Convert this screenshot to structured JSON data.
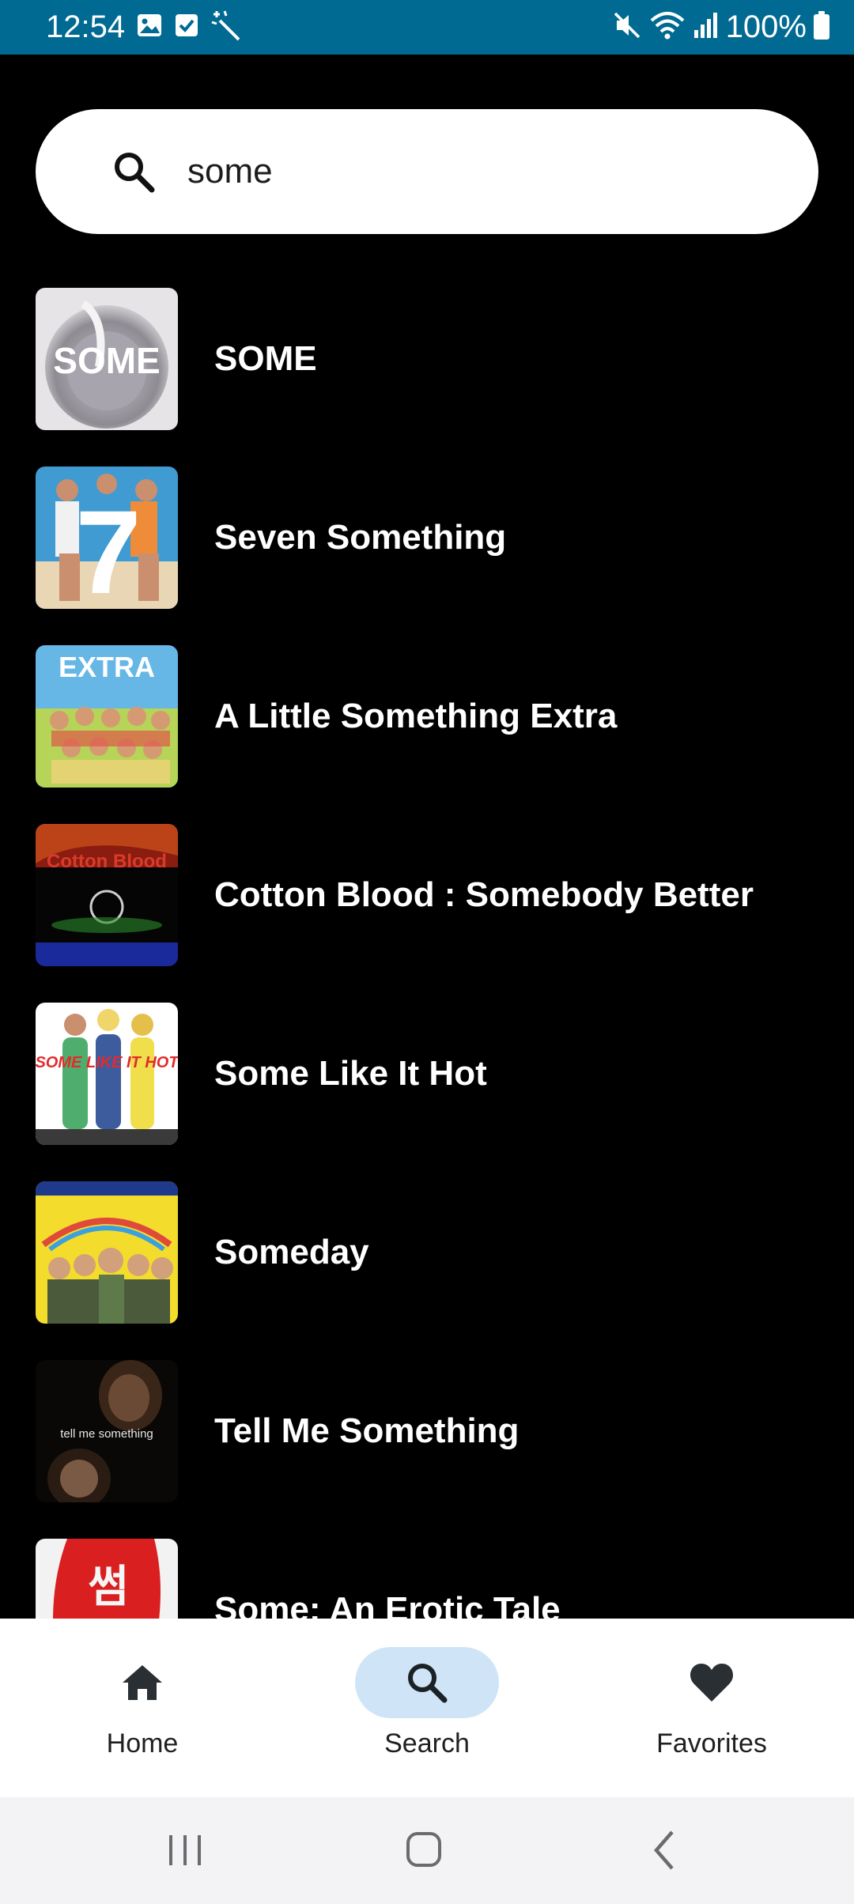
{
  "status_bar": {
    "time": "12:54",
    "left_icons": [
      "image-icon",
      "checkbox-icon",
      "magic-wand-icon"
    ],
    "right_icons": [
      "mute-icon",
      "wifi-icon",
      "signal-icon",
      "battery-icon"
    ],
    "battery_text": "100%",
    "background_color": "#006a93"
  },
  "search": {
    "value": "some",
    "icon": "search-icon"
  },
  "results": [
    {
      "title": "SOME",
      "poster_text": "SOME"
    },
    {
      "title": "Seven Something",
      "poster_text": "7"
    },
    {
      "title": "A Little Something Extra",
      "poster_text": "EXTRA"
    },
    {
      "title": "Cotton Blood : Somebody Better",
      "poster_text": "Cotton Blood"
    },
    {
      "title": "Some Like It Hot",
      "poster_text": "SOME LIKE IT HOT"
    },
    {
      "title": "Someday",
      "poster_text": ""
    },
    {
      "title": "Tell Me Something",
      "poster_text": "tell me something"
    },
    {
      "title": "Some: An Erotic Tale",
      "poster_text": "썸"
    }
  ],
  "bottom_nav": {
    "items": [
      {
        "label": "Home",
        "icon": "home-icon",
        "active": false
      },
      {
        "label": "Search",
        "icon": "search-icon",
        "active": true
      },
      {
        "label": "Favorites",
        "icon": "heart-icon",
        "active": false
      }
    ],
    "active_pill_color": "#cfe5f7"
  },
  "system_nav": {
    "buttons": [
      "recents-icon",
      "home-circle-icon",
      "back-icon"
    ]
  }
}
